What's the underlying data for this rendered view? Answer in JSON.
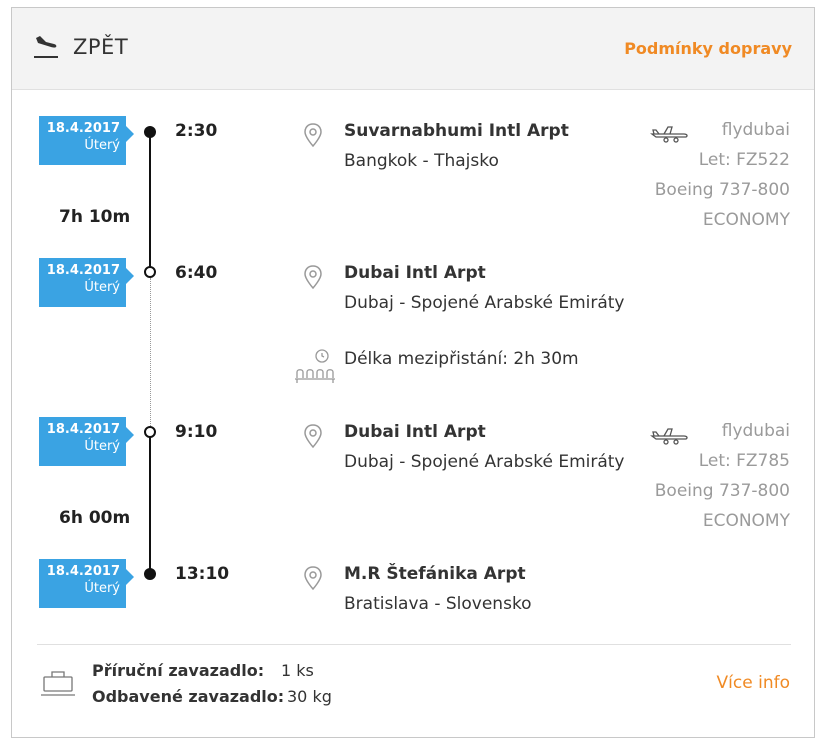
{
  "header": {
    "icon": "plane-landing-icon",
    "title": "ZPĚT",
    "conditions_link": "Podmínky dopravy"
  },
  "segments": [
    {
      "departure": {
        "date": "18.4.2017",
        "weekday": "Úterý",
        "time": "2:30",
        "airport": "Suvarnabhumi Intl Arpt",
        "city": "Bangkok - Thajsko"
      },
      "duration": "7h 10m",
      "arrival": {
        "date": "18.4.2017",
        "weekday": "Úterý",
        "time": "6:40",
        "airport": "Dubai Intl Arpt",
        "city": "Dubaj - Spojené Arabské Emiráty"
      },
      "carrier": {
        "airline": "flydubai",
        "flight": "Let: FZ522",
        "aircraft": "Boeing 737-800",
        "cabin": "ECONOMY"
      }
    },
    {
      "departure": {
        "date": "18.4.2017",
        "weekday": "Úterý",
        "time": "9:10",
        "airport": "Dubai Intl Arpt",
        "city": "Dubaj - Spojené Arabské Emiráty"
      },
      "duration": "6h 00m",
      "arrival": {
        "date": "18.4.2017",
        "weekday": "Úterý",
        "time": "13:10",
        "airport": "M.R Štefánika Arpt",
        "city": "Bratislava - Slovensko"
      },
      "carrier": {
        "airline": "flydubai",
        "flight": "Let: FZ785",
        "aircraft": "Boeing 737-800",
        "cabin": "ECONOMY"
      }
    }
  ],
  "layover": {
    "text": "Délka mezipřistání: 2h 30m"
  },
  "baggage": {
    "cabin_label": "Příruční zavazadlo:",
    "cabin_value": "1 ks",
    "checked_label": "Odbavené zavazadlo:",
    "checked_value": "30 kg",
    "more_link": "Více info"
  }
}
